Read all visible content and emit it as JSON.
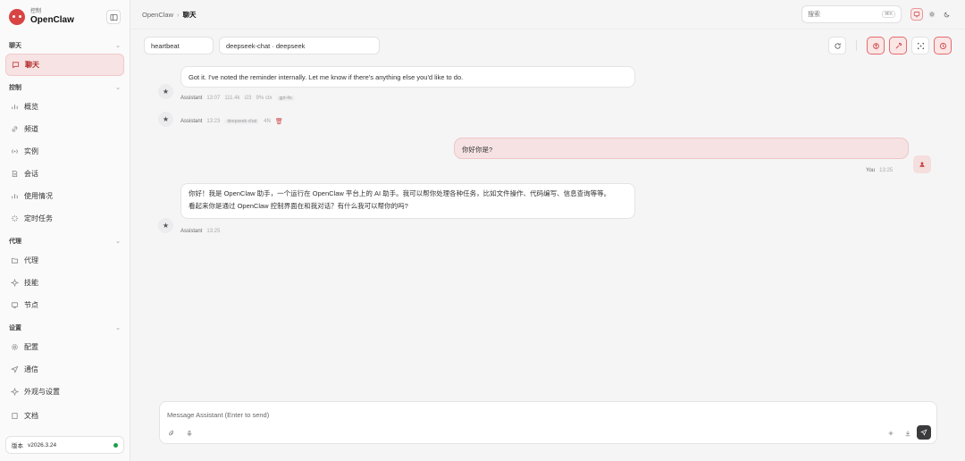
{
  "brand": {
    "small": "控制",
    "name": "OpenClaw"
  },
  "sidebar": {
    "sections": [
      {
        "title": "聊天",
        "items": [
          {
            "label": "聊天",
            "icon": "message-icon",
            "active": true
          }
        ]
      },
      {
        "title": "控制",
        "items": [
          {
            "label": "概览",
            "icon": "bar-chart-icon"
          },
          {
            "label": "频道",
            "icon": "link-icon"
          },
          {
            "label": "实例",
            "icon": "broadcast-icon"
          },
          {
            "label": "会话",
            "icon": "document-icon"
          },
          {
            "label": "使用情况",
            "icon": "bar-chart-icon"
          },
          {
            "label": "定时任务",
            "icon": "loader-icon"
          }
        ]
      },
      {
        "title": "代理",
        "items": [
          {
            "label": "代理",
            "icon": "folder-icon"
          },
          {
            "label": "技能",
            "icon": "sparkle-icon"
          },
          {
            "label": "节点",
            "icon": "monitor-icon"
          }
        ]
      },
      {
        "title": "设置",
        "items": [
          {
            "label": "配置",
            "icon": "gear-icon"
          },
          {
            "label": "通信",
            "icon": "send-icon"
          },
          {
            "label": "外观与设置",
            "icon": "sparkle-icon"
          }
        ]
      },
      {
        "title": "",
        "items": [
          {
            "label": "文档",
            "icon": "book-icon"
          }
        ]
      }
    ],
    "version_label": "版本",
    "version": "v2026.3.24"
  },
  "header": {
    "breadcrumb": [
      "OpenClaw",
      "聊天"
    ],
    "search_placeholder": "搜索",
    "search_shortcut": "⌘K"
  },
  "toolbar": {
    "session": "heartbeat",
    "model": "deepseek-chat · deepseek"
  },
  "messages": [
    {
      "role": "assistant",
      "text": "Got it. I've noted the reminder internally. Let me know if there's anything else you'd like to do.",
      "sender": "Assistant",
      "time": "13:07",
      "tokens": "111.4k",
      "count": "i23",
      "ctx": "9% ctx",
      "model_tag": "gpt-4o"
    },
    {
      "role": "assistant",
      "text": "",
      "sender": "Assistant",
      "time": "13:23",
      "model_tag": "deepseek-chat",
      "extra": "4N"
    },
    {
      "role": "user",
      "text": "你好你是?",
      "sender": "You",
      "time": "13:25"
    },
    {
      "role": "assistant",
      "lines": [
        "你好！我是 OpenClaw 助手，一个运行在 OpenClaw 平台上的 AI 助手。我可以帮你处理各种任务，比如文件操作、代码编写、信息查询等等。",
        "看起来你是通过 OpenClaw 控制界面在和我对话？有什么我可以帮你的吗?"
      ],
      "sender": "Assistant",
      "time": "13:25"
    }
  ],
  "composer": {
    "placeholder": "Message Assistant (Enter to send)"
  },
  "colors": {
    "accent": "#d84444",
    "active_bg": "#f7e3e3",
    "online": "#1e9e4a"
  }
}
